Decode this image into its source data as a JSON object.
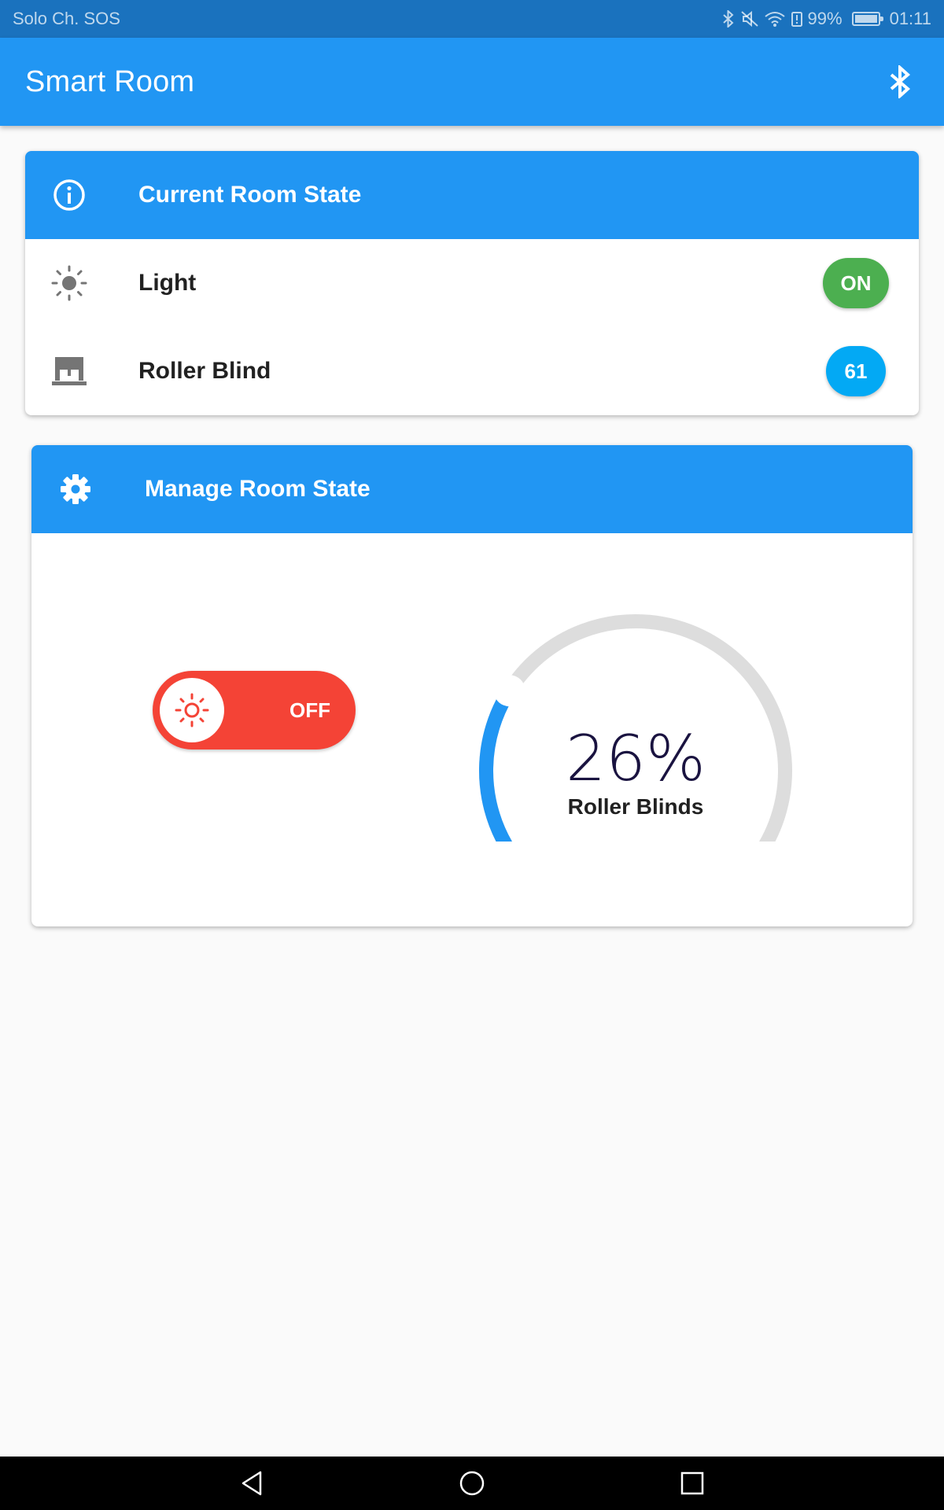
{
  "status_bar": {
    "carrier": "Solo Ch. SOS",
    "battery": "99%",
    "time": "01:11",
    "icons": [
      "bluetooth-icon",
      "mute-icon",
      "wifi-icon",
      "battery-alert-icon",
      "battery-icon"
    ]
  },
  "app_bar": {
    "title": "Smart Room",
    "action_icon": "bluetooth-icon"
  },
  "current_state": {
    "header_icon": "info-icon",
    "title": "Current Room State",
    "items": [
      {
        "icon": "sun-icon",
        "label": "Light",
        "value": "ON",
        "value_color": "#4caf50"
      },
      {
        "icon": "roller-blind-icon",
        "label": "Roller Blind",
        "value": "61",
        "value_color": "#03a9f4"
      }
    ]
  },
  "manage_state": {
    "header_icon": "gear-icon",
    "title": "Manage Room State",
    "light_toggle": {
      "icon": "sun-icon",
      "state": "OFF",
      "color": "#f44336"
    },
    "blind_gauge": {
      "value": "26%",
      "level": 0.26,
      "label": "Roller Blinds",
      "active_color": "#2196f3",
      "track_color": "#dddddd"
    }
  },
  "nav_bar": {
    "buttons": [
      "back-icon",
      "home-icon",
      "recents-icon"
    ]
  },
  "colors": {
    "primary": "#2196f3",
    "status_bar": "#1a72be",
    "background": "#fafafa"
  }
}
